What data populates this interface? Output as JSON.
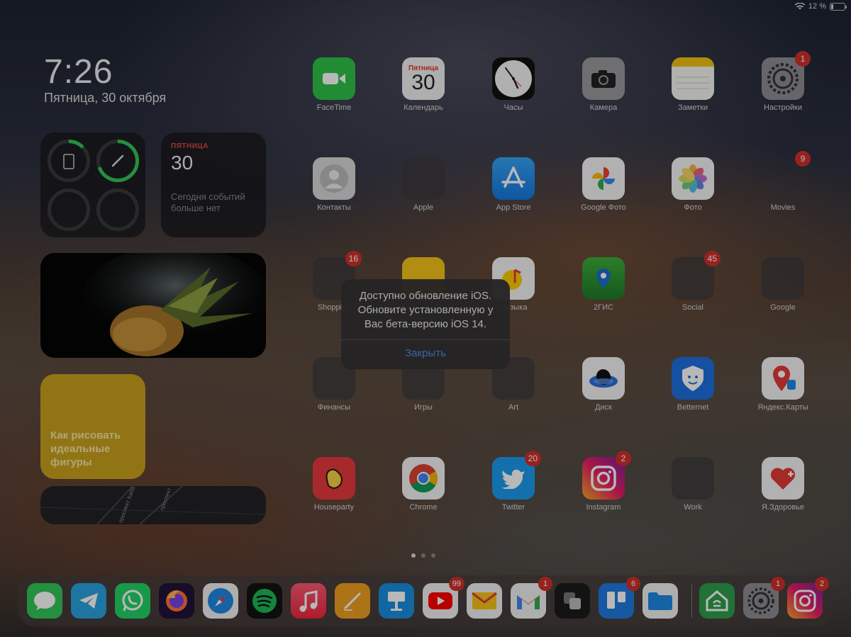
{
  "status_bar": {
    "battery_text": "12 %",
    "battery_level": 0.12
  },
  "clock": {
    "time": "7:26",
    "date": "Пятница, 30 октября"
  },
  "widgets": {
    "calendar": {
      "day": "ПЯТНИЦА",
      "date": "30",
      "message": "Сегодня событий больше нет"
    },
    "notes": {
      "text": "Как рисовать идеальные фигуры"
    },
    "map": {
      "street1": "проспект Каба",
      "street2": "проспект"
    }
  },
  "apps": {
    "facetime": {
      "label": "FaceTime"
    },
    "calendar": {
      "label": "Календарь",
      "day": "Пятница",
      "num": "30"
    },
    "clock": {
      "label": "Часы"
    },
    "camera": {
      "label": "Камера"
    },
    "notes": {
      "label": "Заметки"
    },
    "settings": {
      "label": "Настройки",
      "badge": "1"
    },
    "contacts": {
      "label": "Контакты"
    },
    "apple": {
      "label": "Apple"
    },
    "appstore": {
      "label": "App Store"
    },
    "gphotos": {
      "label": "Google Фото"
    },
    "photos": {
      "label": "Фото"
    },
    "movies": {
      "label": "Movies",
      "badge": "9"
    },
    "shopping": {
      "label": "Shopping",
      "badge": "16"
    },
    "beeline": {
      "label": ""
    },
    "music": {
      "label": "Музыка"
    },
    "twogis": {
      "label": "2ГИС"
    },
    "social": {
      "label": "Social",
      "badge": "45"
    },
    "google": {
      "label": "Google"
    },
    "finance": {
      "label": "Финансы"
    },
    "games": {
      "label": "Игры"
    },
    "art": {
      "label": "Art"
    },
    "disk": {
      "label": "Диск"
    },
    "betternet": {
      "label": "Betternet"
    },
    "ymaps": {
      "label": "Яндекс.Карты"
    },
    "houseparty": {
      "label": "Houseparty"
    },
    "chrome": {
      "label": "Chrome"
    },
    "twitter": {
      "label": "Twitter",
      "badge": "20"
    },
    "instagram": {
      "label": "Instagram",
      "badge": "2"
    },
    "work": {
      "label": "Work"
    },
    "yhealth": {
      "label": "Я.Здоровье"
    }
  },
  "alert": {
    "message": "Доступно обновление iOS. Обновите установленную у Вас бета-версию iOS 14.",
    "button": "Закрыть"
  },
  "dock": {
    "youtube_badge": "99",
    "gmail_badge": "1",
    "trello_badge": "6",
    "settings_badge": "1",
    "instagram_badge": "2"
  }
}
